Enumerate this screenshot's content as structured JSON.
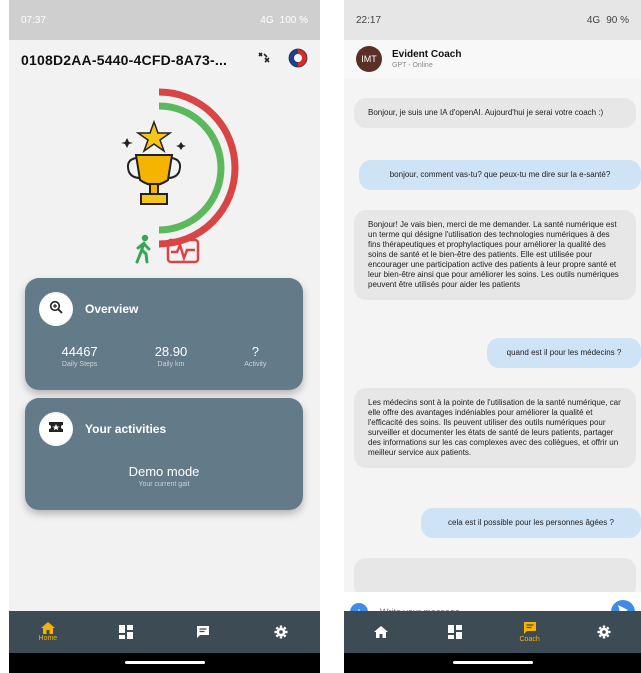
{
  "left": {
    "status": {
      "time": "07:37",
      "right": "4G",
      "battery": "100 %"
    },
    "device_id": "0108D2AA-5440-4CFD-8A73-...",
    "overview": {
      "title": "Overview",
      "stats": [
        {
          "value": "44467",
          "label": "Daily Steps"
        },
        {
          "value": "28.90",
          "label": "Daily km"
        },
        {
          "value": "?",
          "label": "Activity"
        }
      ]
    },
    "activities": {
      "title": "Your activities",
      "mode": "Demo mode",
      "subtitle": "Your current gait"
    },
    "nav": {
      "home_label": "Home"
    }
  },
  "right": {
    "status": {
      "time": "22:17",
      "right": "4G",
      "battery": "90 %"
    },
    "chat": {
      "avatar": "IMT",
      "name": "Evident Coach",
      "status": "GPT - Online"
    },
    "messages": [
      {
        "role": "bot",
        "text": "Bonjour, je suis une IA d'openAI. Aujourd'hui je serai votre coach :)"
      },
      {
        "role": "user",
        "text": "bonjour, comment vas-tu? que peux-tu me dire sur la e-santé?"
      },
      {
        "role": "bot",
        "text": "Bonjour! Je vais bien, merci de me demander. La santé numérique est un terme qui désigne l'utilisation des technologies numériques à des fins thérapeutiques et prophylactiques pour améliorer la qualité des soins de santé et le bien-être des patients. Elle est utilisée pour encourager une participation active des patients à leur propre santé et leur bien-être ainsi que pour améliorer les soins. Les outils numériques peuvent être utilisés pour aider les patients"
      },
      {
        "role": "user",
        "text": "quand est il pour les médecins ?"
      },
      {
        "role": "bot",
        "text": "Les médecins sont à la pointe de l'utilisation de la santé numérique, car elle offre des avantages indéniables pour améliorer la qualité et l'efficacité des soins. Ils peuvent utiliser des outils numériques pour surveiller et documenter les états de santé de leurs patients, partager des informations sur les cas complexes avec des collègues, et offrir un meilleur service aux patients."
      },
      {
        "role": "user",
        "text": "cela est il possible pour les personnes âgées ?"
      }
    ],
    "composer": {
      "placeholder": "Write your message"
    },
    "nav": {
      "coach_label": "Coach"
    }
  },
  "colors": {
    "card": "#637a89",
    "nav": "#3d4b55",
    "accent": "#f5b400",
    "bubble_user": "#cfe3f7",
    "bubble_bot": "#e7e7e7",
    "blue": "#3f8ce6"
  }
}
